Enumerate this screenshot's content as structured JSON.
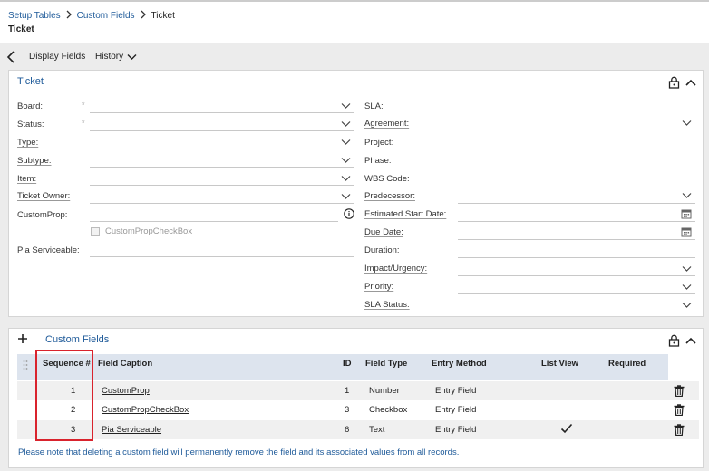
{
  "breadcrumb": {
    "items": [
      "Setup Tables",
      "Custom Fields",
      "Ticket"
    ]
  },
  "page": {
    "title": "Ticket"
  },
  "toolbar": {
    "display_fields": "Display Fields",
    "history": "History"
  },
  "ticket_panel": {
    "title": "Ticket",
    "left_fields": [
      {
        "label": "Board:",
        "required": "*",
        "kind": "dropdown"
      },
      {
        "label": "Status:",
        "required": "*",
        "kind": "dropdown"
      },
      {
        "label": "Type:",
        "kind": "dropdown"
      },
      {
        "label": "Subtype:",
        "kind": "dropdown"
      },
      {
        "label": "Item:",
        "kind": "dropdown"
      },
      {
        "label": "Ticket Owner:",
        "kind": "dropdown"
      },
      {
        "label": "CustomProp:",
        "kind": "text-info"
      },
      {
        "label": "CustomPropCheckBox",
        "kind": "checkbox"
      },
      {
        "label": "Pia Serviceable:",
        "kind": "text"
      }
    ],
    "right_fields": [
      {
        "label": "SLA:"
      },
      {
        "label": "Agreement:"
      },
      {
        "label": "Project:"
      },
      {
        "label": "Phase:"
      },
      {
        "label": "WBS Code:"
      },
      {
        "label": "Predecessor:"
      },
      {
        "label": "Estimated Start Date:"
      },
      {
        "label": "Due Date:"
      },
      {
        "label": "Duration:"
      },
      {
        "label": "Impact/Urgency:"
      },
      {
        "label": "Priority:"
      },
      {
        "label": "SLA Status:"
      }
    ]
  },
  "custom_fields": {
    "title": "Custom Fields",
    "columns": {
      "sequence": "Sequence #",
      "caption": "Field Caption",
      "id": "ID",
      "type": "Field Type",
      "entry": "Entry Method",
      "list_view": "List View",
      "required": "Required"
    },
    "rows": [
      {
        "sequence": "1",
        "caption": "CustomProp",
        "id": "1",
        "type": "Number",
        "entry": "Entry Field",
        "list_view": false
      },
      {
        "sequence": "2",
        "caption": "CustomPropCheckBox",
        "id": "3",
        "type": "Checkbox",
        "entry": "Entry Field",
        "list_view": false
      },
      {
        "sequence": "3",
        "caption": "Pia Serviceable",
        "id": "6",
        "type": "Text",
        "entry": "Entry Field",
        "list_view": true
      }
    ],
    "note": "Please note that deleting a custom field will permanently remove the field and its associated values from all records."
  },
  "colors": {
    "link": "#1e5a99",
    "highlight": "#d9232d",
    "header_bg": "#dde4ee"
  },
  "icons": {
    "back": "chevron-left-icon",
    "history": "chevron-down-icon",
    "lock": "lock-icon",
    "collapse": "chevron-up-icon",
    "add": "plus-icon",
    "delete": "trash-icon",
    "info": "info-icon",
    "calendar": "calendar-icon",
    "drag": "drag-handle-icon",
    "check": "checkmark-icon"
  }
}
